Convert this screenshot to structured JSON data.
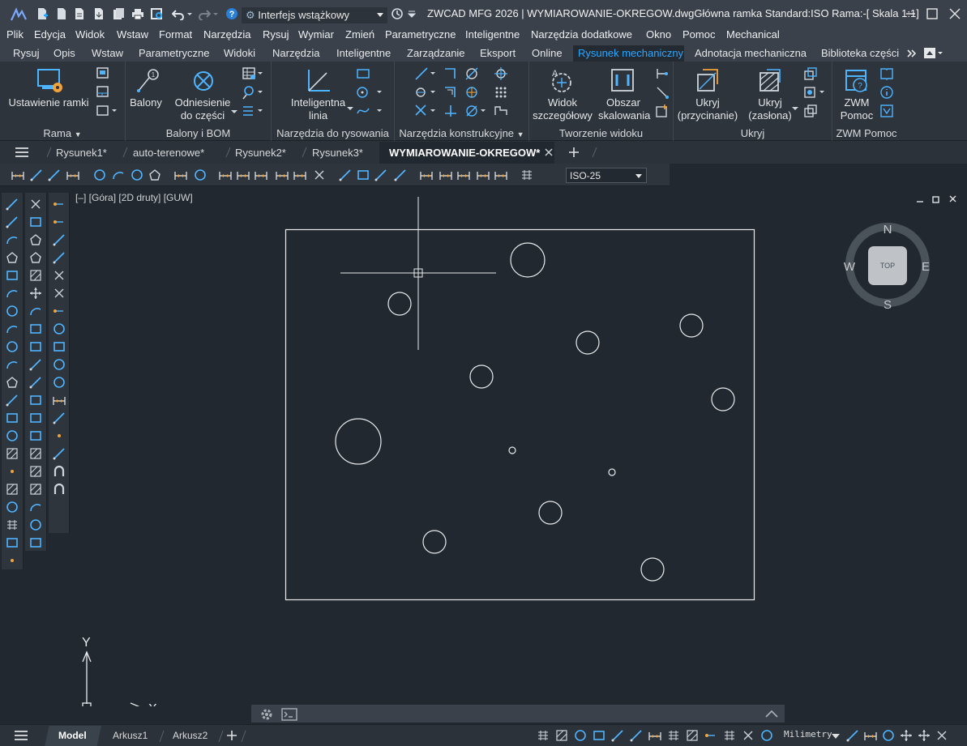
{
  "titlebar": {
    "workspace": "Interfejs wstążkowy",
    "window_title": "ZWCAD MFG 2026 | WYMIAROWANIE-OKREGOW.dwgGłówna ramka  Standard:ISO Rama:-[ Skala 1:1]"
  },
  "menu": {
    "items": [
      "Plik",
      "Edycja",
      "Widok",
      "Wstaw",
      "Format",
      "Narzędzia",
      "Rysuj",
      "Wymiar",
      "Zmień",
      "Parametryczne",
      "Inteligentne",
      "Narzędzia dodatkowe",
      "Okno",
      "Pomoc",
      "Mechanical"
    ]
  },
  "ribbon_tabs": {
    "items": [
      "Rysuj",
      "Opis",
      "Wstaw",
      "Parametryczne",
      "Widoki",
      "Narzędzia",
      "Inteligentne",
      "Zarządzanie",
      "Eksport",
      "Online",
      "Rysunek mechaniczny",
      "Adnotacja mechaniczna",
      "Biblioteka części"
    ],
    "active": "Rysunek mechaniczny"
  },
  "ribbon": {
    "rama": {
      "title": "Rama",
      "big": "Ustawienie ramki"
    },
    "balony": {
      "title": "Balony i BOM",
      "balony": "Balony",
      "odn1": "Odniesienie",
      "odn2": "do części"
    },
    "narz_rys": {
      "title": "Narzędzia do rysowania",
      "intel1": "Inteligentna",
      "intel2": "linia"
    },
    "narz_konstr": {
      "title": "Narzędzia konstrukcyjne"
    },
    "tworzenie": {
      "title": "Tworzenie widoku",
      "w1": "Widok",
      "w2": "szczegółowy",
      "o1": "Obszar",
      "o2": "skalowania"
    },
    "ukryj": {
      "title": "Ukryj",
      "u1a": "Ukryj",
      "u1b": "(przycinanie)",
      "u2a": "Ukryj",
      "u2b": "(zasłona)"
    },
    "zwm": {
      "title": "ZWM Pomoc",
      "z1": "ZWM",
      "z2": "Pomoc"
    }
  },
  "doc_tabs": {
    "items": [
      "Rysunek1*",
      "auto-terenowe*",
      "Rysunek2*",
      "Rysunek3*",
      "WYMIAROWANIE-OKREGOW*"
    ],
    "active": "WYMIAROWANIE-OKREGOW*"
  },
  "dim_toolbar": {
    "style": "ISO-25"
  },
  "viewport": {
    "label": "[–] [Góra] [2D druty] [GUW]",
    "viewcube": {
      "top": "TOP",
      "n": "N",
      "s": "S",
      "e": "E",
      "w": "W"
    },
    "ucs": {
      "x": "X",
      "y": "Y"
    }
  },
  "layout_tabs": {
    "items": [
      "Model",
      "Arkusz1",
      "Arkusz2"
    ],
    "active": "Model"
  },
  "status": {
    "units": "Milimetry"
  },
  "colors": {
    "accent": "#2aa8ff",
    "canvas": "#212830",
    "chrome": "#3a414b"
  }
}
